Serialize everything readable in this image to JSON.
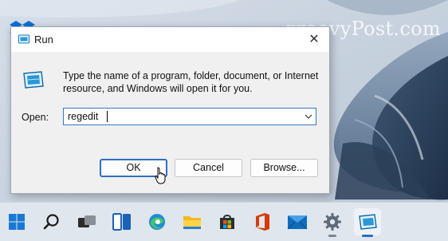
{
  "watermark": "groovyPost.com",
  "dialog": {
    "title": "Run",
    "close_glyph": "✕",
    "description": "Type the name of a program, folder, document, or Internet resource, and Windows will open it for you.",
    "open_label": "Open:",
    "open_value": "regedit",
    "buttons": {
      "ok": "OK",
      "cancel": "Cancel",
      "browse": "Browse..."
    }
  },
  "taskbar": {
    "items": [
      {
        "name": "start",
        "icon": "windows-logo-icon"
      },
      {
        "name": "search",
        "icon": "search-icon"
      },
      {
        "name": "task-view",
        "icon": "task-view-icon"
      },
      {
        "name": "widgets",
        "icon": "widgets-icon"
      },
      {
        "name": "edge",
        "icon": "edge-icon"
      },
      {
        "name": "file-explorer",
        "icon": "folder-icon"
      },
      {
        "name": "microsoft-store",
        "icon": "store-icon"
      },
      {
        "name": "office",
        "icon": "office-icon"
      },
      {
        "name": "mail",
        "icon": "mail-icon"
      },
      {
        "name": "settings",
        "icon": "gear-icon"
      },
      {
        "name": "run",
        "icon": "run-icon",
        "active": true
      }
    ]
  },
  "colors": {
    "accent": "#2f6fc6",
    "dialog_bg": "#f0f0f0",
    "taskbar_bg": "#dfe6ee"
  }
}
